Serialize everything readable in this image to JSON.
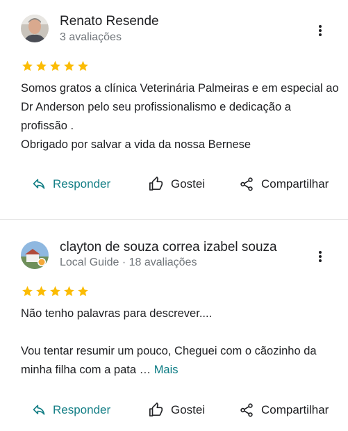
{
  "reviews": [
    {
      "author": "Renato Resende",
      "meta": "3 avaliações",
      "rating": 5,
      "text": "Somos gratos a clínica Veterinária Palmeiras e em especial ao Dr Anderson pelo seu profissionalismo e dedicação a profissão .\nObrigado por salvar a vida da nossa Bernese",
      "more_label": "",
      "actions": {
        "reply": "Responder",
        "like": "Gostei",
        "share": "Compartilhar"
      }
    },
    {
      "author": "clayton de souza correa izabel souza",
      "meta": "Local Guide · 18 avaliações",
      "rating": 5,
      "text": "Não tenho palavras para descrever....\n\nVou tentar resumir um pouco, Cheguei com o cãozinho da minha filha com a pata … ",
      "more_label": "Mais",
      "actions": {
        "reply": "Responder",
        "like": "Gostei",
        "share": "Compartilhar"
      }
    }
  ],
  "colors": {
    "star": "#fbbc04",
    "accent": "#137e85",
    "muted": "#70757a"
  },
  "icons": {
    "reply": "reply-arrow-icon",
    "like": "thumbs-up-icon",
    "share": "share-icon",
    "menu": "more-vert-icon"
  }
}
